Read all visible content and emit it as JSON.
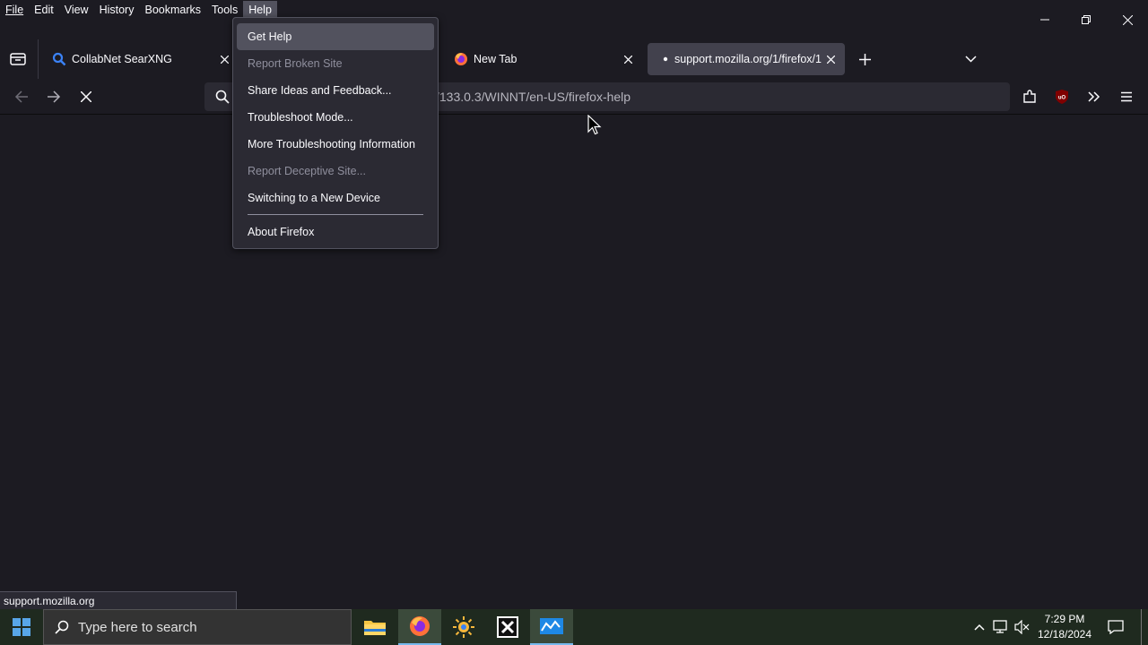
{
  "menubar": {
    "items": [
      "File",
      "Edit",
      "View",
      "History",
      "Bookmarks",
      "Tools",
      "Help"
    ],
    "active": "Help"
  },
  "tabs": [
    {
      "title": "CollabNet SearXNG",
      "icon": "search-icon",
      "selected": false
    },
    {
      "title": "New Tab",
      "icon": "firefox-icon",
      "selected": false
    },
    {
      "title": "support.mozilla.org/1/firefox/1",
      "icon": "loading-dot-icon",
      "selected": true
    }
  ],
  "urlbar": {
    "visible_text": "/133.0.3/WINNT/en-US/firefox-help"
  },
  "help_menu": {
    "items": [
      {
        "label": "Get Help",
        "disabled": false,
        "hover": true
      },
      {
        "label": "Report Broken Site",
        "disabled": true
      },
      {
        "label": "Share Ideas and Feedback...",
        "disabled": false
      },
      {
        "label": "Troubleshoot Mode...",
        "disabled": false
      },
      {
        "label": "More Troubleshooting Information",
        "disabled": false
      },
      {
        "label": "Report Deceptive Site...",
        "disabled": true
      },
      {
        "label": "Switching to a New Device",
        "disabled": false
      },
      {
        "label": "About Firefox",
        "disabled": false
      }
    ]
  },
  "status_text": "support.mozilla.org",
  "taskbar": {
    "search_placeholder": "Type here to search",
    "time": "7:29 PM",
    "date": "12/18/2024"
  },
  "colors": {
    "background": "#1c1b22",
    "toolbar": "#2b2a33",
    "selected_tab": "#42414d",
    "ublock": "#800000"
  }
}
